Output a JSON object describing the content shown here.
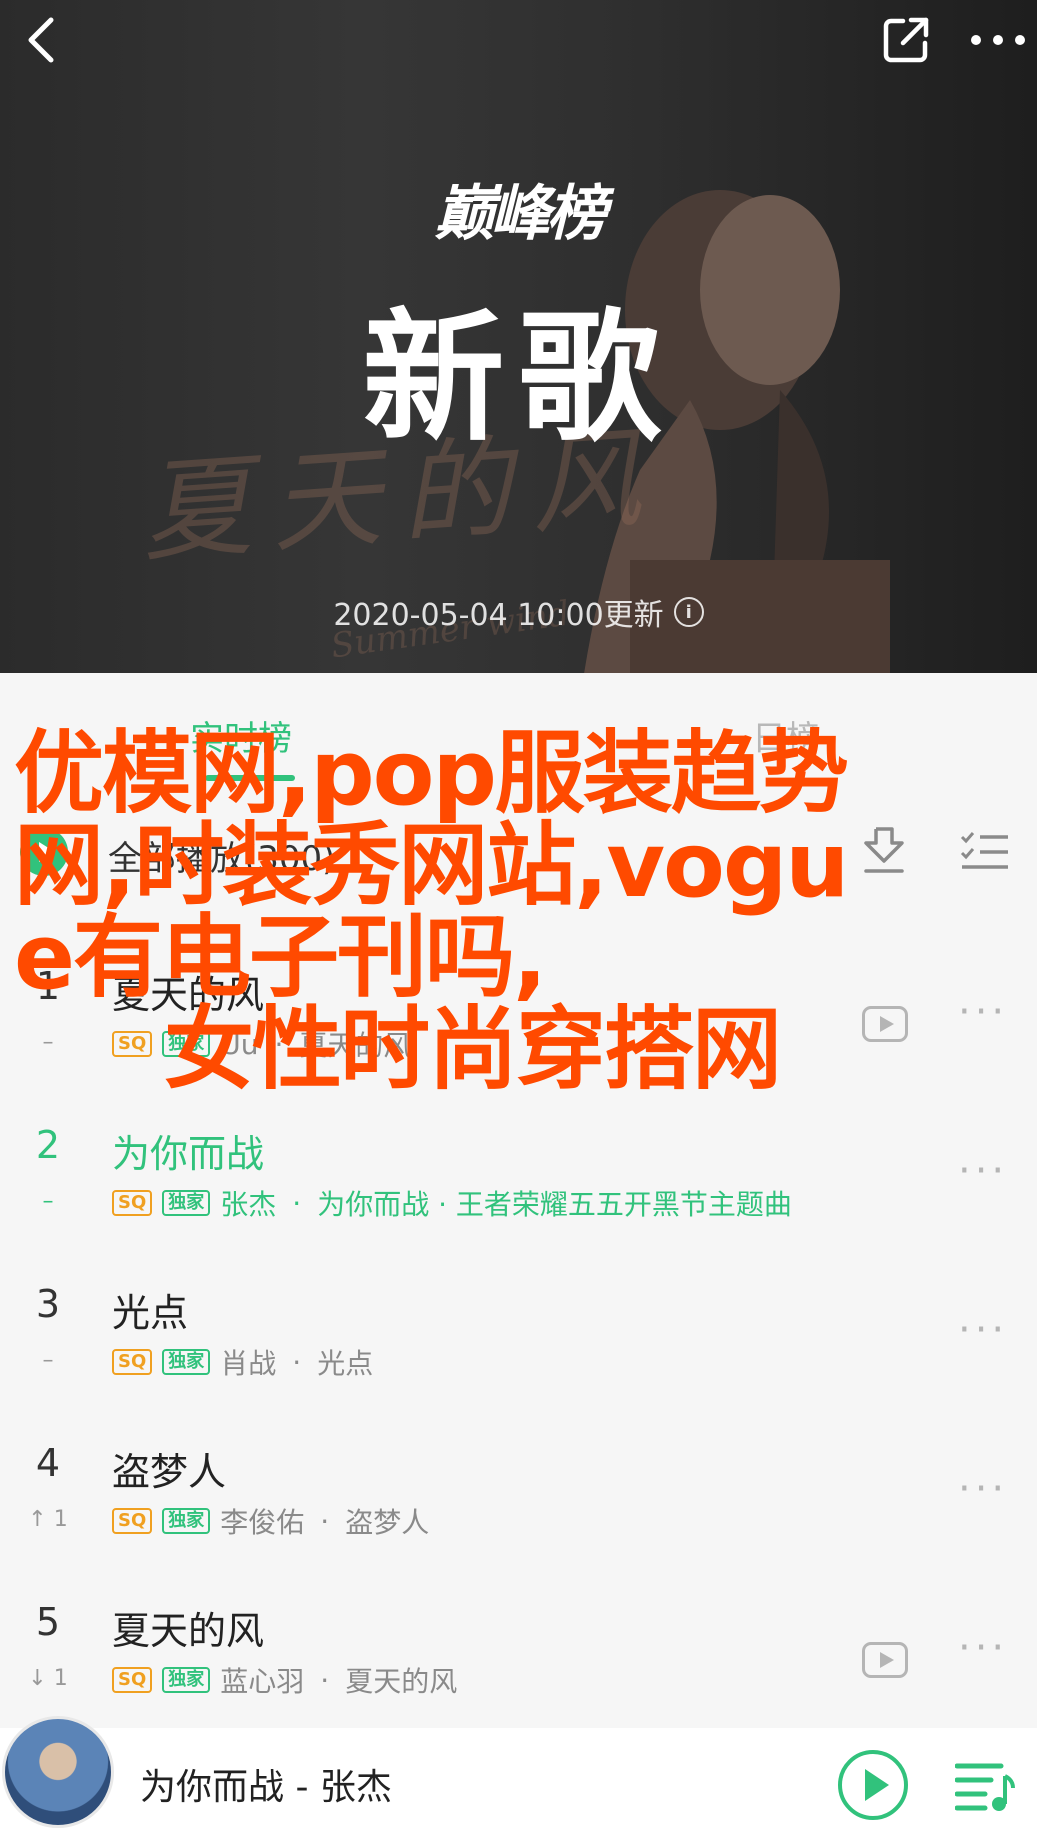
{
  "header": {
    "brand": "巅峰榜",
    "title": "新歌",
    "update_text": "2020-05-04  10:00更新",
    "cover_script": "夏天的风",
    "cover_script_sub": "Summer wind"
  },
  "tabs": [
    {
      "label": "实时榜",
      "active": true
    },
    {
      "label": "日榜",
      "active": false
    }
  ],
  "play_all": {
    "label": "全部播放(300)"
  },
  "songs": [
    {
      "rank": "1",
      "trend": "–",
      "title": "夏天的风",
      "artist": "Uu",
      "album": "夏天的风",
      "has_mv": true
    },
    {
      "rank": "2",
      "trend": "–",
      "title": "为你而战",
      "artist": "张杰",
      "album": "为你而战 · 王者荣耀五五开黑节主题曲",
      "has_mv": false,
      "current": true
    },
    {
      "rank": "3",
      "trend": "–",
      "title": "光点",
      "artist": "肖战",
      "album": "光点",
      "has_mv": false
    },
    {
      "rank": "4",
      "trend": "↑ 1",
      "title": "盗梦人",
      "artist": "李俊佑",
      "album": "盗梦人",
      "has_mv": false
    },
    {
      "rank": "5",
      "trend": "↓ 1",
      "title": "夏天的风",
      "artist": "蓝心羽",
      "album": "夏天的风",
      "has_mv": true
    }
  ],
  "badges": {
    "sq": "SQ",
    "exclusive": "独家"
  },
  "overlay_text": {
    "line1": "优模网,pop服装趋势网,时装秀网站,vogue有电子刊吗,",
    "line2": "女性时尚穿搭网"
  },
  "player": {
    "now_playing": "为你而战 - 张杰"
  },
  "icons": [
    "back-icon",
    "share-icon",
    "more-icon",
    "info-icon",
    "play-icon",
    "download-icon",
    "multi-select-icon",
    "mv-icon",
    "playlist-icon"
  ],
  "colors": {
    "accent": "#31c27c",
    "overlay": "#ff4a00",
    "sq": "#f0a020"
  }
}
